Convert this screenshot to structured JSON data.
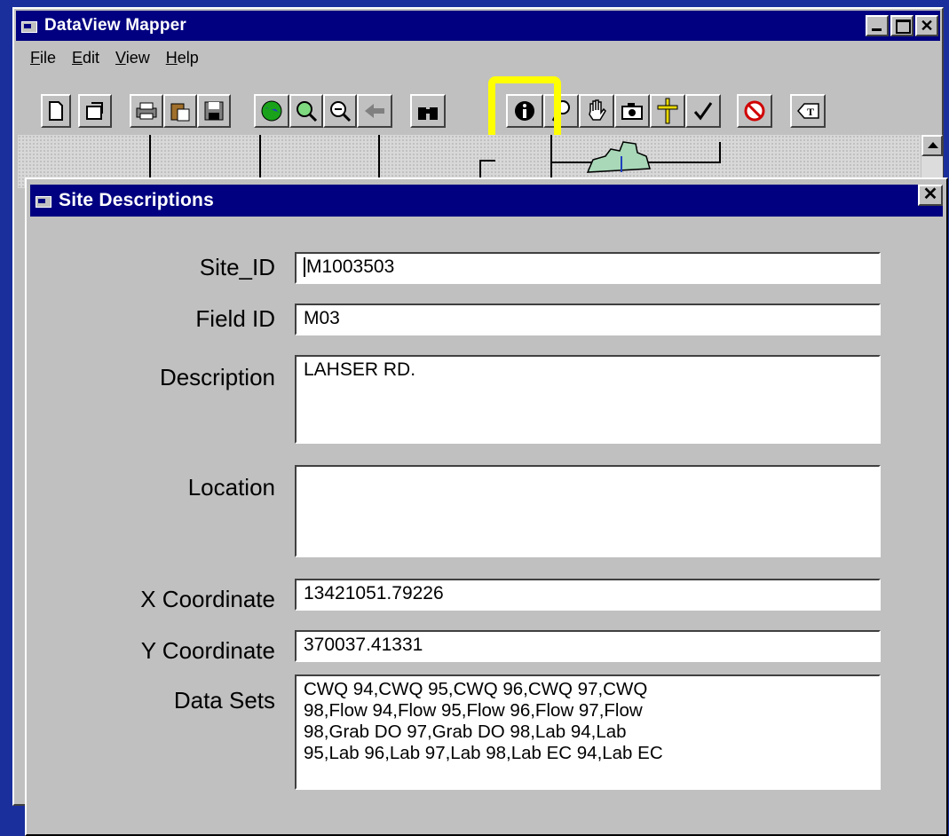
{
  "app": {
    "title": "DataView Mapper",
    "menu": [
      {
        "label": "File",
        "mnemonic": "F",
        "rest": "ile"
      },
      {
        "label": "Edit",
        "mnemonic": "E",
        "rest": "dit"
      },
      {
        "label": "View",
        "mnemonic": "V",
        "rest": "iew"
      },
      {
        "label": "Help",
        "mnemonic": "H",
        "rest": "elp"
      }
    ],
    "toolbar_icons": [
      "new-file-icon",
      "properties-icon",
      "print-icon",
      "paste-icon",
      "save-icon",
      "globe-icon",
      "zoom-in-icon",
      "zoom-out-icon",
      "back-arrow-icon",
      "find-binoculars-icon",
      "info-icon",
      "query-icon",
      "pan-hand-icon",
      "camera-icon",
      "cross-marker-icon",
      "checkmark-icon",
      "no-entry-icon",
      "text-label-icon"
    ]
  },
  "dialog": {
    "title": "Site Descriptions",
    "close_label": "✕",
    "fields": {
      "site_id": {
        "label": "Site_ID",
        "value": "M1003503"
      },
      "field_id": {
        "label": "Field ID",
        "value": "M03"
      },
      "description": {
        "label": "Description",
        "value": "LAHSER RD."
      },
      "location": {
        "label": "Location",
        "value": ""
      },
      "x_coordinate": {
        "label": "X Coordinate",
        "value": "13421051.79226"
      },
      "y_coordinate": {
        "label": "Y Coordinate",
        "value": "370037.41331"
      },
      "data_sets": {
        "label": "Data Sets",
        "value": "CWQ 94,CWQ 95,CWQ 96,CWQ 97,CWQ\n98,Flow 94,Flow 95,Flow 96,Flow 97,Flow\n98,Grab DO 97,Grab DO 98,Lab 94,Lab\n95,Lab 96,Lab 97,Lab 98,Lab EC 94,Lab EC"
      }
    }
  },
  "colors": {
    "titlebar": "#000080",
    "highlight": "#ffff00",
    "background": "#1a2f9c"
  }
}
